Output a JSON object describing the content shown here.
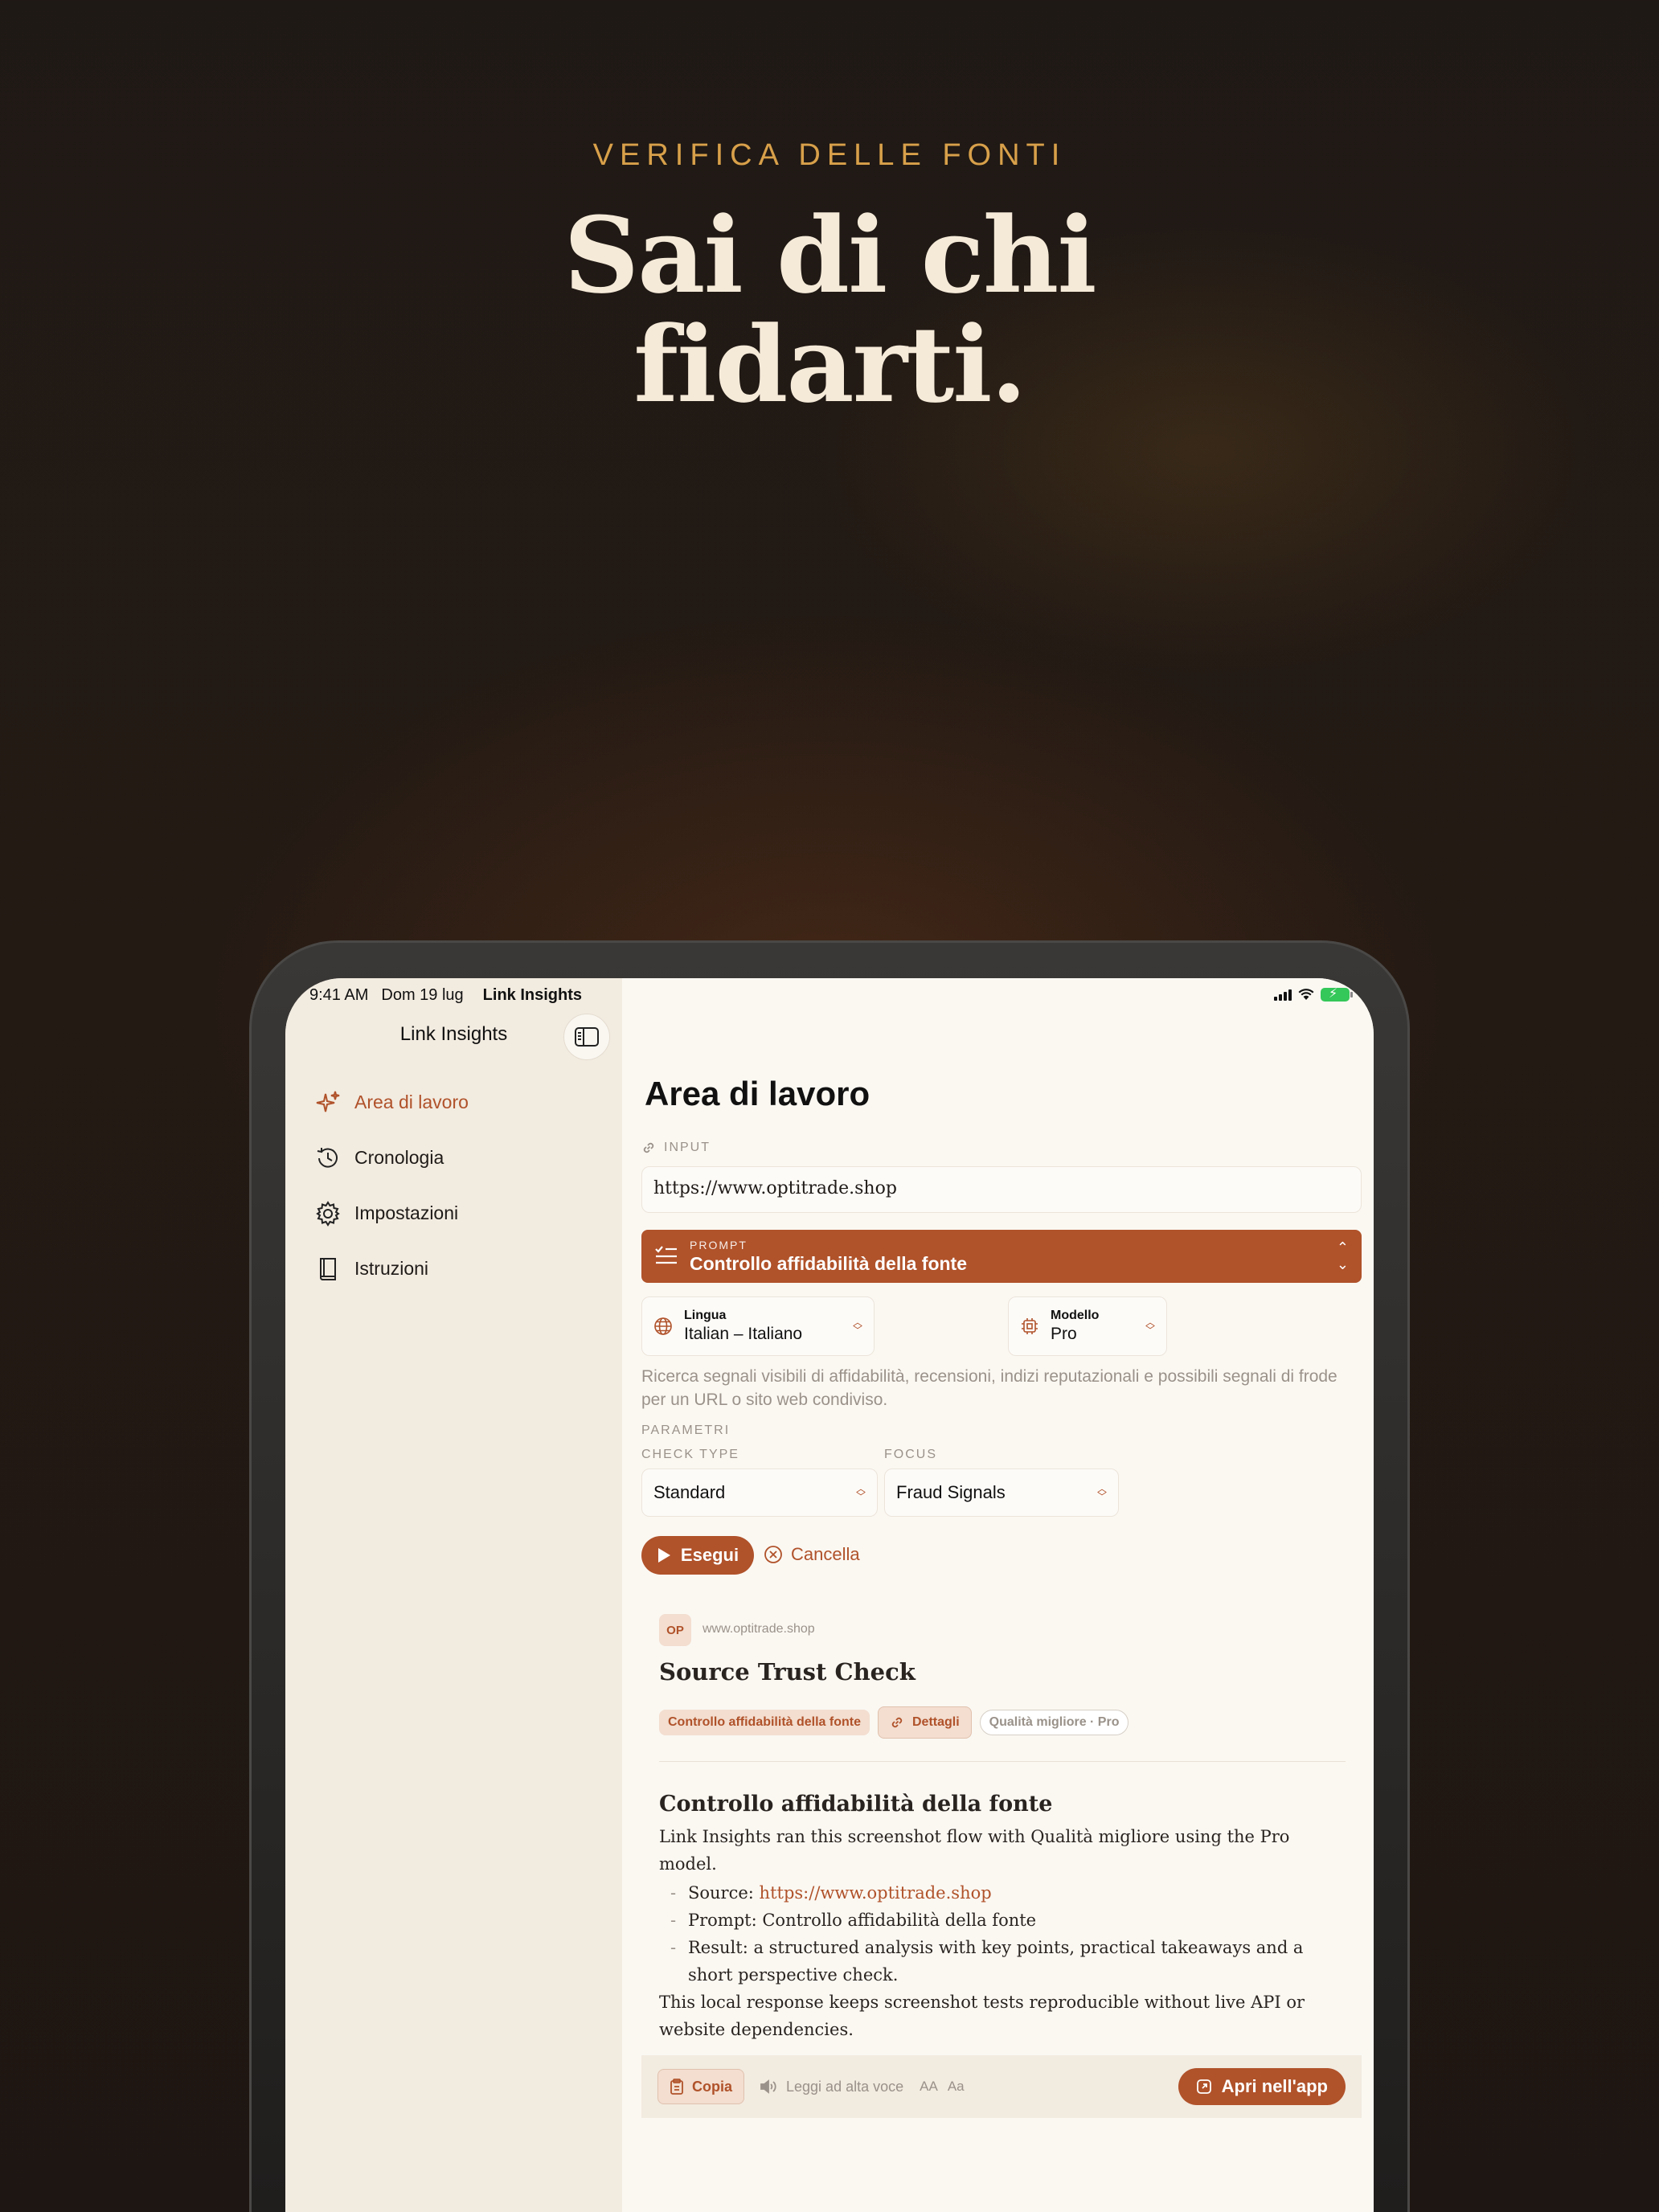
{
  "hero": {
    "kicker": "VERIFICA DELLE FONTI",
    "headline_line1": "Sai di chi",
    "headline_line2": "fidarti."
  },
  "status_bar": {
    "time": "9:41 AM",
    "date": "Dom 19 lug",
    "app": "Link Insights"
  },
  "sidebar": {
    "title": "Link Insights",
    "items": [
      {
        "label": "Area di lavoro",
        "icon": "sparkle-icon",
        "active": true
      },
      {
        "label": "Cronologia",
        "icon": "history-icon",
        "active": false
      },
      {
        "label": "Impostazioni",
        "icon": "gear-icon",
        "active": false
      },
      {
        "label": "Istruzioni",
        "icon": "book-icon",
        "active": false
      }
    ]
  },
  "workspace": {
    "title": "Area di lavoro",
    "input_label": "INPUT",
    "url_value": "https://www.optitrade.shop",
    "prompt": {
      "key": "PROMPT",
      "value": "Controllo affidabilità della fonte"
    },
    "language": {
      "key": "Lingua",
      "value": "Italian – Italiano"
    },
    "model": {
      "key": "Modello",
      "value": "Pro"
    },
    "description": "Ricerca segnali visibili di affidabilità, recensioni, indizi reputazionali e possibili segnali di frode per un URL o sito web condiviso.",
    "params_label": "PARAMETRI",
    "check_type_label": "CHECK TYPE",
    "check_type_value": "Standard",
    "focus_label": "FOCUS",
    "focus_value": "Fraud Signals",
    "run_label": "Esegui",
    "cancel_label": "Cancella"
  },
  "result": {
    "badge": "OP",
    "domain": "www.optitrade.shop",
    "title": "Source Trust Check",
    "chip_prompt": "Controllo affidabilità della fonte",
    "chip_details": "Dettagli",
    "chip_quality": "Qualità migliore · Pro",
    "heading": "Controllo affidabilità della fonte",
    "intro": "Link Insights ran this screenshot flow with Qualità migliore using the Pro model.",
    "source_prefix": "Source: ",
    "source_link": "https://www.optitrade.shop",
    "prompt_line": "Prompt: Controllo affidabilità della fonte",
    "result_line": "Result: a structured analysis with key points, practical takeaways and a short perspective check.",
    "outro": "This local response keeps screenshot tests reproducible without live API or website dependencies."
  },
  "footer": {
    "copy": "Copia",
    "read_aloud": "Leggi ad alta voce",
    "aa_small": "AA",
    "aa_large": "Aa",
    "open_app": "Apri nell'app"
  },
  "colors": {
    "accent": "#b0522a",
    "gold": "#d8a04a",
    "headline": "#f5ead8"
  }
}
